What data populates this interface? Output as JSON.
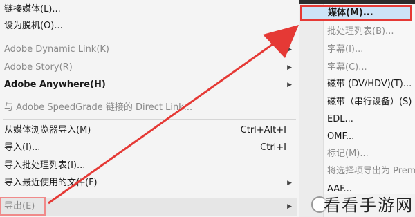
{
  "main_menu": {
    "items": [
      {
        "label": "链接媒体(L)...",
        "disabled": false
      },
      {
        "label": "设为脱机(O)...",
        "disabled": false
      },
      {
        "label": "Adobe Dynamic Link(K)",
        "disabled": true
      },
      {
        "label": "Adobe Story(R)",
        "disabled": true
      },
      {
        "label": "Adobe Anywhere(H)",
        "disabled": false
      },
      {
        "label": "与 Adobe SpeedGrade 链接的 Direct Link...",
        "disabled": true
      },
      {
        "label": "从媒体浏览器导入(M)",
        "shortcut": "Ctrl+Alt+I",
        "disabled": false
      },
      {
        "label": "导入(I)...",
        "shortcut": "Ctrl+I",
        "disabled": false
      },
      {
        "label": "导入批处理列表(I)...",
        "disabled": false
      },
      {
        "label": "导入最近使用的文件(F)",
        "disabled": false
      },
      {
        "label": "导出(E)",
        "disabled": true
      }
    ]
  },
  "submenu": {
    "items": [
      {
        "label": "媒体(M)..."
      },
      {
        "label": "批处理列表(B)..."
      },
      {
        "label": "字幕(I)..."
      },
      {
        "label": "字幕(C)..."
      },
      {
        "label": "磁带 (DV/HDV)(T)..."
      },
      {
        "label": "磁带（串行设备）(S)"
      },
      {
        "label": "EDL..."
      },
      {
        "label": "OMF..."
      },
      {
        "label": "标记(M)..."
      },
      {
        "label": "将选择项导出为 Premiere"
      },
      {
        "label": "AAF..."
      }
    ]
  },
  "watermark": {
    "text": "看看手游网"
  },
  "colors": {
    "annotation_red": "#e53935",
    "highlight": "#cde3f7"
  },
  "icons": {
    "submenu_arrow": "chevron-right-icon",
    "pointer": "red-arrow-annotation"
  }
}
